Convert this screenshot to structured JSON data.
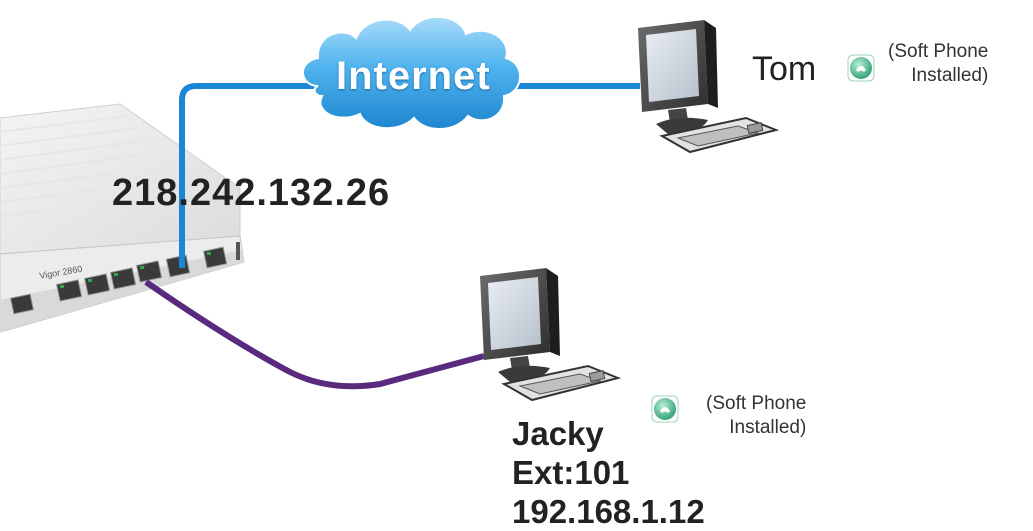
{
  "cloud": {
    "label": "Internet"
  },
  "router": {
    "wan_ip": "218.242.132.26",
    "model_text": "Vigor"
  },
  "tom": {
    "name": "Tom",
    "softphone_line1": "(Soft Phone",
    "softphone_line2": "Installed)"
  },
  "jacky": {
    "name": "Jacky",
    "ext": "Ext:101",
    "ip": "192.168.1.12",
    "softphone_line1": "(Soft Phone",
    "softphone_line2": "Installed)"
  },
  "colors": {
    "wan_link": "#1a86d4",
    "lan_link": "#5a2a7e",
    "cloud_fill": "#4fb3ee",
    "softphone_icon": "#2eae7e"
  },
  "icons": [
    "internet-cloud-icon",
    "router-icon",
    "computer-icon",
    "softphone-icon"
  ]
}
